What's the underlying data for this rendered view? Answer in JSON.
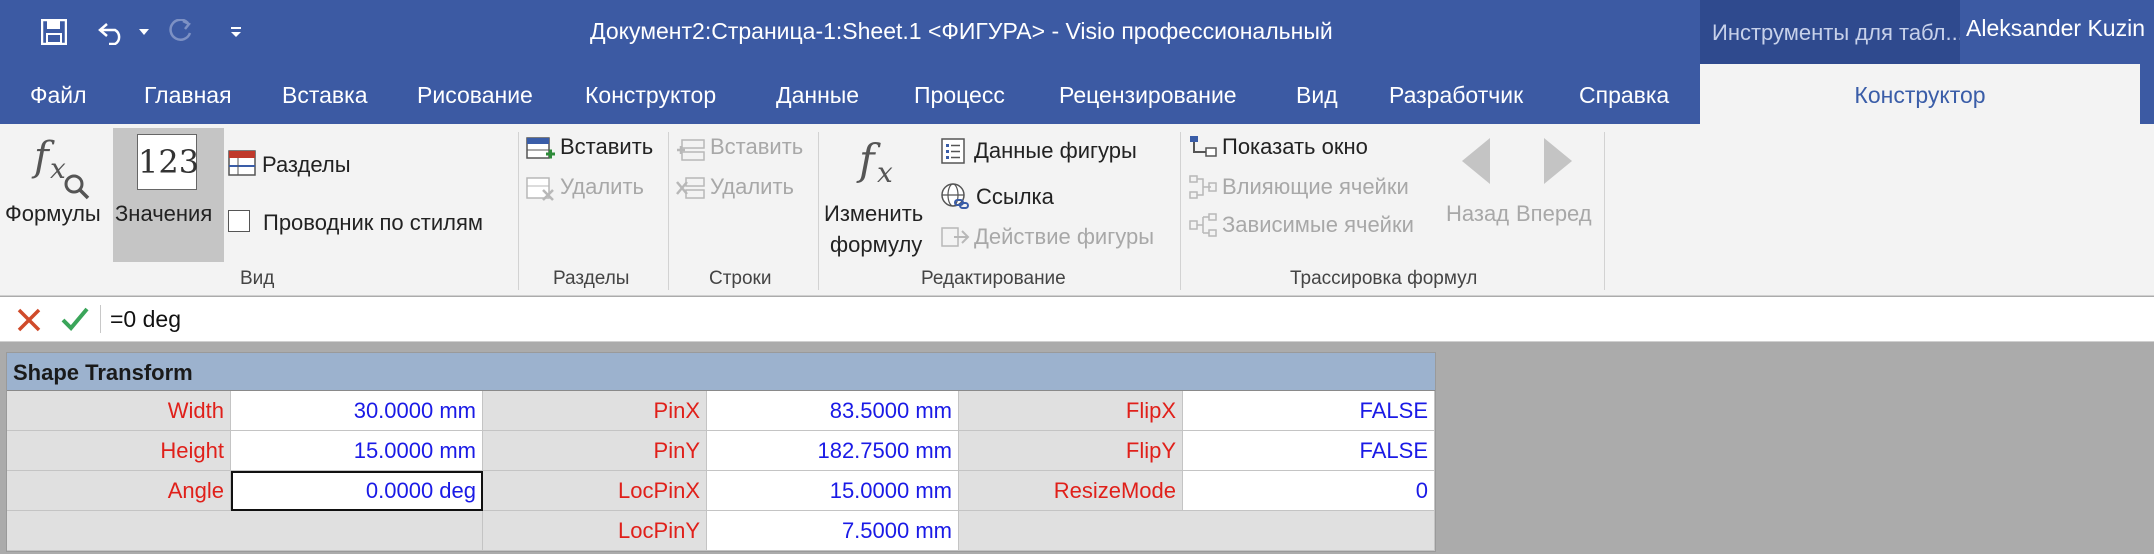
{
  "title_bar": {
    "document_title": "Документ2:Страница-1:Sheet.1  <ФИГУРА>   -   Visio профессиональный",
    "contextual_group": "Инструменты для табл...",
    "user_name": "Aleksander Kuzin"
  },
  "tabs": [
    {
      "label": "Файл"
    },
    {
      "label": "Главная"
    },
    {
      "label": "Вставка"
    },
    {
      "label": "Рисование"
    },
    {
      "label": "Конструктор"
    },
    {
      "label": "Данные"
    },
    {
      "label": "Процесс"
    },
    {
      "label": "Рецензирование"
    },
    {
      "label": "Вид"
    },
    {
      "label": "Разработчик"
    },
    {
      "label": "Справка"
    }
  ],
  "active_contextual_tab": "Конструктор",
  "ribbon": {
    "view": {
      "label": "Вид",
      "formulas": "Формулы",
      "values": "Значения",
      "values_icon_text": "123",
      "sections": "Разделы",
      "style_explorer": "Проводник по стилям"
    },
    "sections_group": {
      "label": "Разделы",
      "insert": "Вставить",
      "delete": "Удалить"
    },
    "rows_group": {
      "label": "Строки",
      "insert": "Вставить",
      "delete": "Удалить"
    },
    "editing": {
      "label": "Редактирование",
      "edit_formula_line1": "Изменить",
      "edit_formula_line2": "формулу",
      "shape_data": "Данные фигуры",
      "link": "Ссылка",
      "shape_action": "Действие фигуры"
    },
    "tracing": {
      "label": "Трассировка формул",
      "show_window": "Показать окно",
      "precedents": "Влияющие ячейки",
      "dependents": "Зависимые ячейки",
      "back": "Назад",
      "forward": "Вперед"
    }
  },
  "formula_bar": {
    "value": "=0 deg"
  },
  "shapesheet": {
    "section_title": "Shape Transform",
    "rows": [
      [
        {
          "label": "Width",
          "value": "30.0000 mm"
        },
        {
          "label": "PinX",
          "value": "83.5000 mm"
        },
        {
          "label": "FlipX",
          "value": "FALSE"
        }
      ],
      [
        {
          "label": "Height",
          "value": "15.0000 mm"
        },
        {
          "label": "PinY",
          "value": "182.7500 mm"
        },
        {
          "label": "FlipY",
          "value": "FALSE"
        }
      ],
      [
        {
          "label": "Angle",
          "value": "0.0000 deg"
        },
        {
          "label": "LocPinX",
          "value": "15.0000 mm"
        },
        {
          "label": "ResizeMode",
          "value": "0"
        }
      ],
      [
        {
          "label": "",
          "value": ""
        },
        {
          "label": "LocPinY",
          "value": "7.5000 mm"
        },
        {
          "label": "",
          "value": ""
        }
      ]
    ]
  },
  "colors": {
    "title_bar": "#3c5aa3",
    "cell_label": "#e0201a",
    "cell_value": "#1a1ae6",
    "section_header": "#9cb2ce"
  }
}
